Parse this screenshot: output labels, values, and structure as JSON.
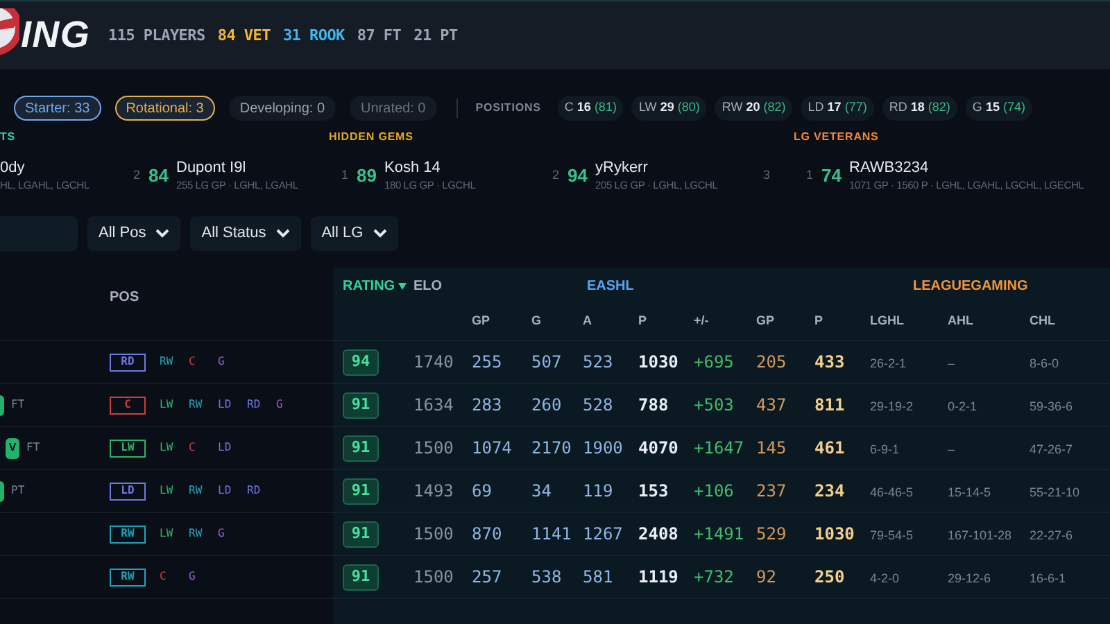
{
  "header": {
    "title": "ING",
    "stats": [
      {
        "text": "115 PLAYERS",
        "color": "#9aa6b8"
      },
      {
        "text": "84 VET",
        "color": "#f2b632"
      },
      {
        "text": "31 ROOK",
        "color": "#3fb6ec"
      },
      {
        "text": "87 FT",
        "color": "#9aa6b8"
      },
      {
        "text": "21 PT",
        "color": "#9aa6b8"
      }
    ]
  },
  "status_filters": [
    {
      "label": "Starter: 33",
      "color": "#6ea8ec",
      "selected": true
    },
    {
      "label": "Rotational: 3",
      "color": "#e2b250",
      "selected": true
    },
    {
      "label": "Developing: 0",
      "color": "#9ca3af",
      "selected": false
    },
    {
      "label": "Unrated: 0",
      "color": "#6b7280",
      "selected": false
    }
  ],
  "positions": {
    "label": "POSITIONS",
    "items": [
      {
        "pos": "C",
        "count": "16",
        "avg": "(81)"
      },
      {
        "pos": "LW",
        "count": "29",
        "avg": "(80)"
      },
      {
        "pos": "RW",
        "count": "20",
        "avg": "(82)"
      },
      {
        "pos": "LD",
        "count": "17",
        "avg": "(77)"
      },
      {
        "pos": "RD",
        "count": "18",
        "avg": "(82)"
      },
      {
        "pos": "G",
        "count": "15",
        "avg": "(74)"
      }
    ]
  },
  "highlights": [
    {
      "title": "TS",
      "color": "#34d399",
      "cards": [
        {
          "name": "0dy",
          "detail": "HL, LGAHL, LGCHL"
        },
        {
          "rank": "2",
          "rating": "84",
          "name": "Dupont I9l",
          "detail": "255 LG GP · LGHL, LGAHL"
        }
      ]
    },
    {
      "title": "HIDDEN GEMS",
      "color": "#e5a823",
      "cards": [
        {
          "rank": "1",
          "rating": "89",
          "name": "Kosh 14",
          "detail": "180 LG GP · LGCHL"
        },
        {
          "rank": "2",
          "rating": "94",
          "name": "yRykerr",
          "detail": "205 LG GP · LGHL, LGCHL"
        },
        {
          "rank": "3"
        }
      ]
    },
    {
      "title": "LG VETERANS",
      "color": "#f08a3a",
      "cards": [
        {
          "rank": "1",
          "rating": "74",
          "name": "RAWB3234",
          "detail": "1071 GP · 1560 P · LGHL, LGAHL, LGCHL, LGECHL"
        }
      ]
    }
  ],
  "filters": {
    "selects": [
      "All Pos",
      "All Status",
      "All LG"
    ]
  },
  "table": {
    "pos_header": "POS",
    "rating_header": "RATING",
    "groups": [
      {
        "label": "EASHL",
        "color": "#5aa0f0"
      },
      {
        "label": "LEAGUEGAMING",
        "color": "#f5943a"
      }
    ],
    "columns": [
      "ELO",
      "GP",
      "G",
      "A",
      "P",
      "+/-",
      "GP",
      "P",
      "LGHL",
      "AHL",
      "CHL"
    ],
    "rows": [
      {
        "pos": {
          "label": "RD",
          "color": "#6f78e0"
        },
        "alt": [
          {
            "label": "RW",
            "color": "#1fa3bd"
          },
          {
            "label": "C",
            "color": "#d23b3b"
          },
          {
            "label": "G",
            "color": "#9a5bd2"
          }
        ],
        "rating": "94",
        "cells": [
          "1740",
          "255",
          "507",
          "523",
          "1030",
          "+695",
          "205",
          "433",
          "26-2-1",
          "–",
          "8-6-0"
        ]
      },
      {
        "tag": {
          "kind": "cut"
        },
        "contract": "FT",
        "pos": {
          "label": "C",
          "color": "#d23b3b"
        },
        "alt": [
          {
            "label": "LW",
            "color": "#2fb36a"
          },
          {
            "label": "RW",
            "color": "#1fa3bd"
          },
          {
            "label": "LD",
            "color": "#6f78e0"
          },
          {
            "label": "RD",
            "color": "#6f78e0"
          },
          {
            "label": "G",
            "color": "#9a5bd2"
          }
        ],
        "rating": "91",
        "cells": [
          "1634",
          "283",
          "260",
          "528",
          "788",
          "+503",
          "437",
          "811",
          "29-19-2",
          "0-2-1",
          "59-36-6"
        ]
      },
      {
        "tag": {
          "kind": "pill",
          "label": "V"
        },
        "contract": "FT",
        "pos": {
          "label": "LW",
          "color": "#2fb36a"
        },
        "alt": [
          {
            "label": "LW",
            "color": "#2fb36a"
          },
          {
            "label": "C",
            "color": "#d23b3b"
          },
          {
            "label": "LD",
            "color": "#6f78e0"
          }
        ],
        "rating": "91",
        "cells": [
          "1500",
          "1074",
          "2170",
          "1900",
          "4070",
          "+1647",
          "145",
          "461",
          "6-9-1",
          "–",
          "47-26-7"
        ]
      },
      {
        "tag": {
          "kind": "cut"
        },
        "contract": "PT",
        "pos": {
          "label": "LD",
          "color": "#6f78e0"
        },
        "alt": [
          {
            "label": "LW",
            "color": "#2fb36a"
          },
          {
            "label": "RW",
            "color": "#1fa3bd"
          },
          {
            "label": "LD",
            "color": "#6f78e0"
          },
          {
            "label": "RD",
            "color": "#6f78e0"
          }
        ],
        "rating": "91",
        "cells": [
          "1493",
          "69",
          "34",
          "119",
          "153",
          "+106",
          "237",
          "234",
          "46-46-5",
          "15-14-5",
          "55-21-10"
        ]
      },
      {
        "pos": {
          "label": "RW",
          "color": "#1fa3bd"
        },
        "alt": [
          {
            "label": "LW",
            "color": "#2fb36a"
          },
          {
            "label": "RW",
            "color": "#1fa3bd"
          },
          {
            "label": "G",
            "color": "#9a5bd2"
          }
        ],
        "rating": "91",
        "cells": [
          "1500",
          "870",
          "1141",
          "1267",
          "2408",
          "+1491",
          "529",
          "1030",
          "79-54-5",
          "167-101-28",
          "22-27-6"
        ]
      },
      {
        "pos": {
          "label": "RW",
          "color": "#1fa3bd"
        },
        "alt": [
          {
            "label": "C",
            "color": "#d23b3b"
          },
          {
            "label": "G",
            "color": "#9a5bd2"
          }
        ],
        "rating": "91",
        "cells": [
          "1500",
          "257",
          "538",
          "581",
          "1119",
          "+732",
          "92",
          "250",
          "4-2-0",
          "29-12-6",
          "16-6-1"
        ]
      }
    ]
  }
}
